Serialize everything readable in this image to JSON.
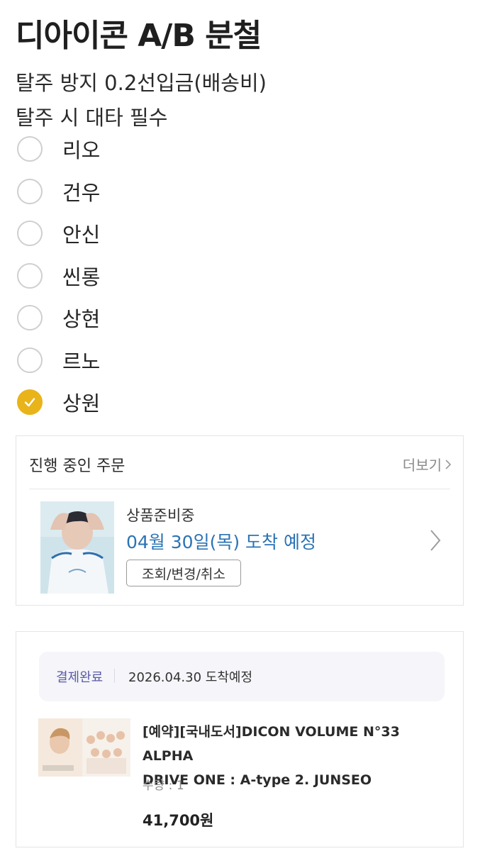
{
  "page": {
    "title": "디아이콘 A/B 분철",
    "subtitle1": "탈주 방지 0.2선입금(배송비)",
    "subtitle2": "탈주 시 대타 필수"
  },
  "options": [
    {
      "label": "리오",
      "checked": false
    },
    {
      "label": "건우",
      "checked": false
    },
    {
      "label": "안신",
      "checked": false
    },
    {
      "label": "씬롱",
      "checked": false
    },
    {
      "label": "상현",
      "checked": false
    },
    {
      "label": "르노",
      "checked": false
    },
    {
      "label": "상원",
      "checked": true
    }
  ],
  "order_card": {
    "title": "진행 중인 주문",
    "more_label": "더보기",
    "status": "상품준비중",
    "eta": "04월 30일(목) 도착 예정",
    "action_label": "조회/변경/취소"
  },
  "payment_card": {
    "status": "결제완료",
    "date_text": "2026.04.30 도착예정",
    "product_line1": "[예약][국내도서]DICON VOLUME N°33 ALPHA",
    "product_line2": "DRIVE ONE : A-type 2. JUNSEO",
    "quantity": "수량 : 1",
    "price": "41,700원"
  },
  "colors": {
    "accent": "#e9b419",
    "eta_blue": "#2b73b5",
    "paid_purple": "#5b5aa6"
  }
}
